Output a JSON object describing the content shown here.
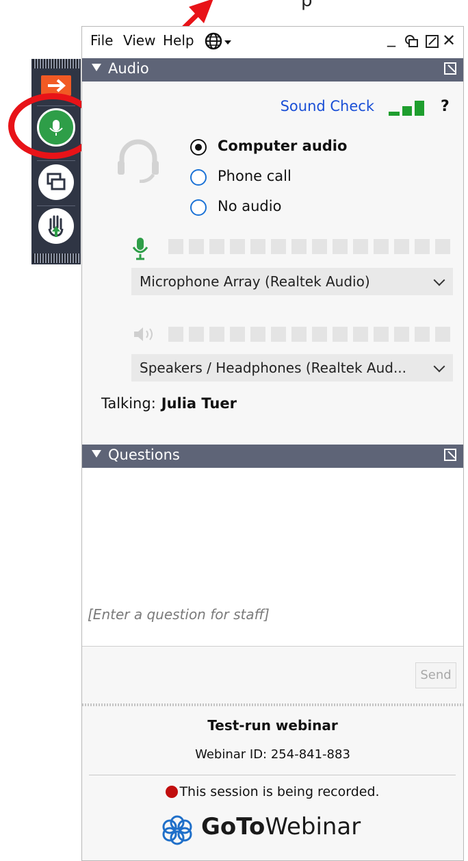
{
  "top_text": "p",
  "menu": {
    "file": "File",
    "view": "View",
    "help": "Help",
    "minimize": "_",
    "close": "✕"
  },
  "audio": {
    "section_title": "Audio",
    "sound_check": "Sound Check",
    "help_mark": "?",
    "options": {
      "computer": "Computer audio",
      "phone": "Phone call",
      "none": "No audio"
    },
    "selected": "computer",
    "microphone_device": "Microphone Array (Realtek Audio)",
    "speaker_device": "Speakers / Headphones (Realtek Aud...",
    "talking_label": "Talking:",
    "talking_name": "Julia Tuer"
  },
  "questions": {
    "section_title": "Questions",
    "placeholder": "[Enter a question for staff]",
    "send_label": "Send"
  },
  "footer": {
    "webinar_title": "Test-run webinar",
    "webinar_id": "Webinar ID: 254-841-883",
    "recording_notice": "This session is being recorded.",
    "logo_bold": "GoTo",
    "logo_regular": "Webinar"
  },
  "colors": {
    "accent_blue": "#1b72d6",
    "sound_green": "#1e9e2e",
    "mic_green": "#2e9e48",
    "section_bar": "#5e6477",
    "highlight_red": "#e81318",
    "record_red": "#c10e0e"
  }
}
